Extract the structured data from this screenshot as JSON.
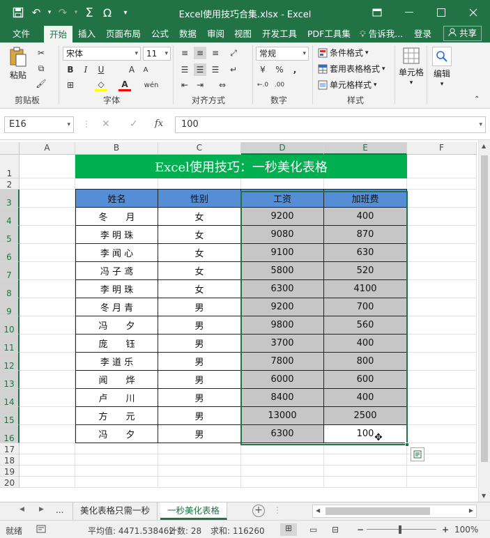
{
  "window": {
    "title": "Excel使用技巧合集.xlsx - Excel",
    "accent": "#217346"
  },
  "qat": {
    "save": "save-icon",
    "undo": "undo-icon",
    "redo": "redo-icon",
    "sum": "Σ",
    "omega": "Ω",
    "more": "▾"
  },
  "tabs": [
    "文件",
    "开始",
    "插入",
    "页面布局",
    "公式",
    "数据",
    "审阅",
    "视图",
    "开发工具",
    "PDF工具集"
  ],
  "active_tab": "开始",
  "tellme": "告诉我...",
  "login": "登录",
  "share": "共享",
  "ribbon": {
    "clipboard": {
      "paste": "粘贴",
      "label": "剪贴板"
    },
    "font": {
      "name": "宋体",
      "size": "11",
      "label": "字体"
    },
    "align": {
      "label": "对齐方式"
    },
    "number": {
      "format": "常规",
      "label": "数字"
    },
    "styles": {
      "cond": "条件格式",
      "table": "套用表格格式",
      "cell": "单元格样式",
      "label": "样式"
    },
    "cells": {
      "label": "单元格"
    },
    "edit": {
      "label": "编辑"
    }
  },
  "formula_bar": {
    "cell_ref": "E16",
    "fx": "fx",
    "value": "100"
  },
  "columns": [
    "A",
    "B",
    "C",
    "D",
    "E",
    "F"
  ],
  "rows": [
    "1",
    "2",
    "3",
    "4",
    "5",
    "6",
    "7",
    "8",
    "9",
    "10",
    "11",
    "12",
    "13",
    "14",
    "15",
    "16",
    "17",
    "18",
    "19",
    "20"
  ],
  "sheet": {
    "banner": "Excel使用技巧：一秒美化表格",
    "banner_color": "#00b050",
    "header_color": "#558ed5",
    "data_fill": "#c6c6c6",
    "headers": [
      "姓名",
      "性别",
      "工资",
      "加班费"
    ],
    "records": [
      [
        "冬　　月",
        "女",
        "9200",
        "400"
      ],
      [
        "李 明 珠",
        "女",
        "9080",
        "870"
      ],
      [
        "李 闻 心",
        "女",
        "9100",
        "630"
      ],
      [
        "冯 子 鸢",
        "女",
        "5800",
        "520"
      ],
      [
        "李 明 珠",
        "女",
        "6300",
        "4100"
      ],
      [
        "冬 月 青",
        "男",
        "9200",
        "700"
      ],
      [
        "冯　　夕",
        "男",
        "9800",
        "560"
      ],
      [
        "庞　　钰",
        "男",
        "3700",
        "400"
      ],
      [
        "李 道 乐",
        "男",
        "7800",
        "800"
      ],
      [
        "闻　　烨",
        "男",
        "6000",
        "600"
      ],
      [
        "卢　　川",
        "男",
        "8400",
        "400"
      ],
      [
        "方　　元",
        "男",
        "13000",
        "2500"
      ],
      [
        "冯　　夕",
        "男",
        "6300",
        "100"
      ]
    ]
  },
  "sheet_tabs": {
    "more": "...",
    "items": [
      "美化表格只需一秒",
      "一秒美化表格"
    ],
    "active": "一秒美化表格"
  },
  "status": {
    "ready": "就绪",
    "average": "平均值: 4471.538462",
    "count": "计数: 28",
    "sum": "求和: 116260",
    "zoom": "100%"
  }
}
